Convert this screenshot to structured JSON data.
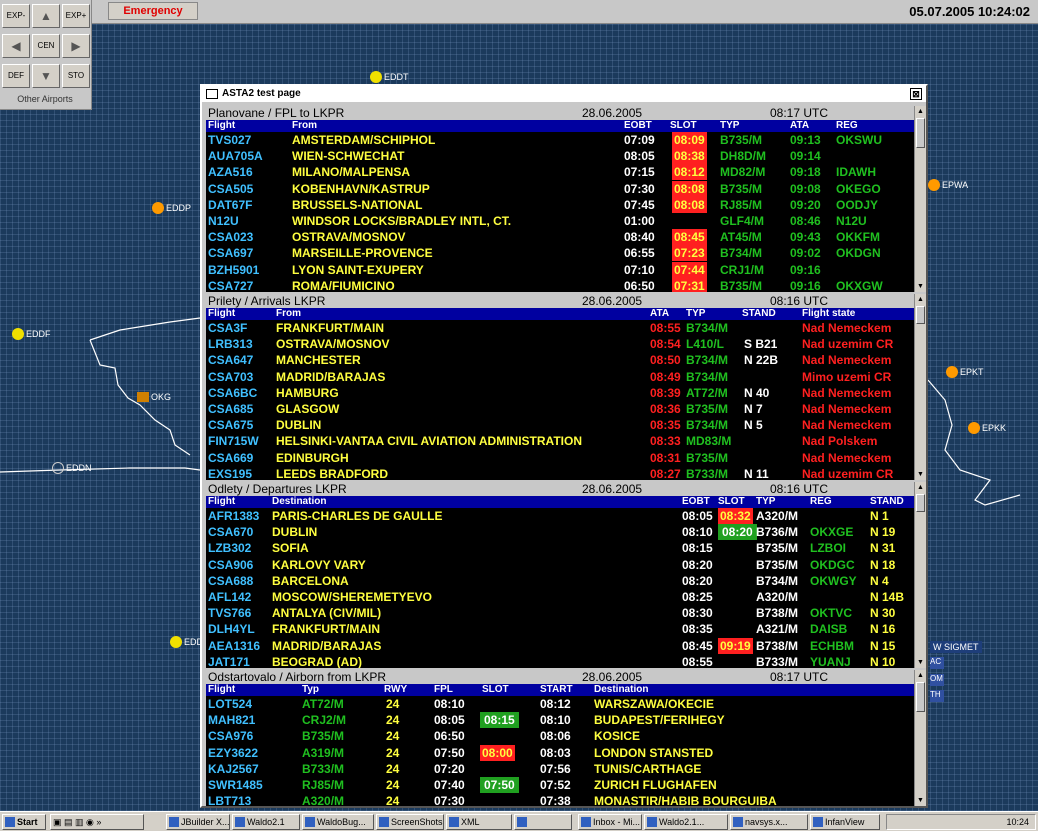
{
  "top_bar": {
    "emergency_label": "Emergency",
    "clock": "05.07.2005 10:24:02",
    "nav": {
      "exp_minus": "EXP-",
      "exp_plus": "EXP+",
      "cen": "CEN",
      "def": "DEF",
      "sto": "STO",
      "other_airports": "Other Airports"
    }
  },
  "map": {
    "airports": [
      "EDDT",
      "EDDP",
      "EDDF",
      "OKG",
      "EDDN",
      "EDD",
      "EPWA",
      "EPKT",
      "EPKK"
    ],
    "sigmet": "W SIGMET",
    "sigmet_tags": [
      "AC",
      "OM",
      "TH"
    ]
  },
  "window": {
    "title": "ASTA2 test page",
    "close": "⊠"
  },
  "fpl": {
    "header": {
      "title": "Planovane / FPL to LKPR",
      "date": "28.06.2005",
      "utc": "08:17 UTC"
    },
    "columns": {
      "flight": "Flight",
      "from": "From",
      "eobt": "EOBT",
      "slot": "SLOT",
      "typ": "TYP",
      "ata": "ATA",
      "reg": "REG"
    },
    "rows": [
      {
        "flight": "TVS027",
        "from": "AMSTERDAM/SCHIPHOL",
        "eobt": "07:09",
        "slot": "08:09",
        "typ": "B735/M",
        "ata": "09:13",
        "reg": "OKSWU"
      },
      {
        "flight": "AUA705A",
        "from": "WIEN-SCHWECHAT",
        "eobt": "08:05",
        "slot": "08:38",
        "typ": "DH8D/M",
        "ata": "09:14",
        "reg": ""
      },
      {
        "flight": "AZA516",
        "from": "MILANO/MALPENSA",
        "eobt": "07:15",
        "slot": "08:12",
        "typ": "MD82/M",
        "ata": "09:18",
        "reg": "IDAWH"
      },
      {
        "flight": "CSA505",
        "from": "KOBENHAVN/KASTRUP",
        "eobt": "07:30",
        "slot": "08:08",
        "typ": "B735/M",
        "ata": "09:08",
        "reg": "OKEGO"
      },
      {
        "flight": "DAT67F",
        "from": "BRUSSELS-NATIONAL",
        "eobt": "07:45",
        "slot": "08:08",
        "typ": "RJ85/M",
        "ata": "09:20",
        "reg": "OODJY"
      },
      {
        "flight": "N12U",
        "from": "WINDSOR LOCKS/BRADLEY INTL, CT.",
        "eobt": "01:00",
        "slot": "",
        "typ": "GLF4/M",
        "ata": "08:46",
        "reg": "N12U"
      },
      {
        "flight": "CSA023",
        "from": "OSTRAVA/MOSNOV",
        "eobt": "08:40",
        "slot": "08:45",
        "typ": "AT45/M",
        "ata": "09:43",
        "reg": "OKKFM"
      },
      {
        "flight": "CSA697",
        "from": "MARSEILLE-PROVENCE",
        "eobt": "06:55",
        "slot": "07:23",
        "typ": "B734/M",
        "ata": "09:02",
        "reg": "OKDGN"
      },
      {
        "flight": "BZH5901",
        "from": "LYON SAINT-EXUPERY",
        "eobt": "07:10",
        "slot": "07:44",
        "typ": "CRJ1/M",
        "ata": "09:16",
        "reg": ""
      },
      {
        "flight": "CSA727",
        "from": "ROMA/FIUMICINO",
        "eobt": "06:50",
        "slot": "07:31",
        "typ": "B735/M",
        "ata": "09:16",
        "reg": "OKXGW"
      }
    ]
  },
  "arrivals": {
    "header": {
      "title": "Prilety / Arrivals  LKPR",
      "date": "28.06.2005",
      "utc": "08:16 UTC"
    },
    "columns": {
      "flight": "Flight",
      "from": "From",
      "ata": "ATA",
      "typ": "TYP",
      "stand": "STAND",
      "state": "Flight state"
    },
    "rows": [
      {
        "flight": "CSA3F",
        "from": "FRANKFURT/MAIN",
        "ata": "08:55",
        "typ": "B734/M",
        "stand": "",
        "state": "Nad Nemeckem"
      },
      {
        "flight": "LRB313",
        "from": "OSTRAVA/MOSNOV",
        "ata": "08:54",
        "typ": "L410/L",
        "stand": "S B21",
        "state": "Nad uzemim CR"
      },
      {
        "flight": "CSA647",
        "from": "MANCHESTER",
        "ata": "08:50",
        "typ": "B734/M",
        "stand": "N 22B",
        "state": "Nad Nemeckem"
      },
      {
        "flight": "CSA703",
        "from": "MADRID/BARAJAS",
        "ata": "08:49",
        "typ": "B734/M",
        "stand": "",
        "state": "Mimo uzemi CR"
      },
      {
        "flight": "CSA6BC",
        "from": "HAMBURG",
        "ata": "08:39",
        "typ": "AT72/M",
        "stand": "N 40",
        "state": "Nad Nemeckem"
      },
      {
        "flight": "CSA685",
        "from": "GLASGOW",
        "ata": "08:36",
        "typ": "B735/M",
        "stand": "N 7",
        "state": "Nad Nemeckem"
      },
      {
        "flight": "CSA675",
        "from": "DUBLIN",
        "ata": "08:35",
        "typ": "B734/M",
        "stand": "N 5",
        "state": "Nad Nemeckem"
      },
      {
        "flight": "FIN715W",
        "from": "HELSINKI-VANTAA CIVIL AVIATION ADMINISTRATION",
        "ata": "08:33",
        "typ": "MD83/M",
        "stand": "",
        "state": "Nad Polskem"
      },
      {
        "flight": "CSA669",
        "from": "EDINBURGH",
        "ata": "08:31",
        "typ": "B735/M",
        "stand": "",
        "state": "Nad Nemeckem"
      },
      {
        "flight": "EXS195",
        "from": "LEEDS BRADFORD",
        "ata": "08:27",
        "typ": "B733/M",
        "stand": "N 11",
        "state": "Nad uzemim CR"
      }
    ]
  },
  "departures": {
    "header": {
      "title": "Odlety / Departures  LKPR",
      "date": "28.06.2005",
      "utc": "08:16 UTC"
    },
    "columns": {
      "flight": "Flight",
      "dest": "Destination",
      "eobt": "EOBT",
      "slot": "SLOT",
      "typ": "TYP",
      "reg": "REG",
      "stand": "STAND"
    },
    "rows": [
      {
        "flight": "AFR1383",
        "dest": "PARIS-CHARLES DE GAULLE",
        "eobt": "08:05",
        "slot": "08:32",
        "slot_color": "red",
        "typ": "A320/M",
        "reg": "",
        "stand": "N 1"
      },
      {
        "flight": "CSA670",
        "dest": "DUBLIN",
        "eobt": "08:10",
        "slot": "08:20",
        "slot_color": "green",
        "typ": "B736/M",
        "reg": "OKXGE",
        "stand": "N 19"
      },
      {
        "flight": "LZB302",
        "dest": "SOFIA",
        "eobt": "08:15",
        "slot": "",
        "slot_color": "",
        "typ": "B735/M",
        "reg": "LZBOI",
        "stand": "N 31"
      },
      {
        "flight": "CSA906",
        "dest": "KARLOVY VARY",
        "eobt": "08:20",
        "slot": "",
        "slot_color": "",
        "typ": "B735/M",
        "reg": "OKDGC",
        "stand": "N 18"
      },
      {
        "flight": "CSA688",
        "dest": "BARCELONA",
        "eobt": "08:20",
        "slot": "",
        "slot_color": "",
        "typ": "B734/M",
        "reg": "OKWGY",
        "stand": "N 4"
      },
      {
        "flight": "AFL142",
        "dest": "MOSCOW/SHEREMETYEVO",
        "eobt": "08:25",
        "slot": "",
        "slot_color": "",
        "typ": "A320/M",
        "reg": "",
        "stand": "N 14B"
      },
      {
        "flight": "TVS766",
        "dest": "ANTALYA (CIV/MIL)",
        "eobt": "08:30",
        "slot": "",
        "slot_color": "",
        "typ": "B738/M",
        "reg": "OKTVC",
        "stand": "N 30"
      },
      {
        "flight": "DLH4YL",
        "dest": "FRANKFURT/MAIN",
        "eobt": "08:35",
        "slot": "",
        "slot_color": "",
        "typ": "A321/M",
        "reg": "DAISB",
        "stand": "N 16"
      },
      {
        "flight": "AEA1316",
        "dest": "MADRID/BARAJAS",
        "eobt": "08:45",
        "slot": "09:19",
        "slot_color": "red",
        "typ": "B738/M",
        "reg": "ECHBM",
        "stand": "N 15"
      },
      {
        "flight": "JAT171",
        "dest": "BEOGRAD (AD)",
        "eobt": "08:55",
        "slot": "",
        "slot_color": "",
        "typ": "B733/M",
        "reg": "YUANJ",
        "stand": "N 10"
      }
    ]
  },
  "airborne": {
    "header": {
      "title": "Odstartovalo / Airborn from LKPR",
      "date": "28.06.2005",
      "utc": "08:17 UTC"
    },
    "columns": {
      "flight": "Flight",
      "typ": "Typ",
      "rwy": "RWY",
      "fpl": "FPL",
      "slot": "SLOT",
      "start": "START",
      "dest": "Destination"
    },
    "rows": [
      {
        "flight": "LOT524",
        "typ": "AT72/M",
        "rwy": "24",
        "fpl": "08:10",
        "slot": "",
        "slot_color": "",
        "start": "08:12",
        "dest": "WARSZAWA/OKECIE"
      },
      {
        "flight": "MAH821",
        "typ": "CRJ2/M",
        "rwy": "24",
        "fpl": "08:05",
        "slot": "08:15",
        "slot_color": "green",
        "start": "08:10",
        "dest": "BUDAPEST/FERIHEGY"
      },
      {
        "flight": "CSA976",
        "typ": "B735/M",
        "rwy": "24",
        "fpl": "06:50",
        "slot": "",
        "slot_color": "",
        "start": "08:06",
        "dest": "KOSICE"
      },
      {
        "flight": "EZY3622",
        "typ": "A319/M",
        "rwy": "24",
        "fpl": "07:50",
        "slot": "08:00",
        "slot_color": "red",
        "start": "08:03",
        "dest": "LONDON STANSTED"
      },
      {
        "flight": "KAJ2567",
        "typ": "B733/M",
        "rwy": "24",
        "fpl": "07:20",
        "slot": "",
        "slot_color": "",
        "start": "07:56",
        "dest": "TUNIS/CARTHAGE"
      },
      {
        "flight": "SWR1485",
        "typ": "RJ85/M",
        "rwy": "24",
        "fpl": "07:40",
        "slot": "07:50",
        "slot_color": "green",
        "start": "07:52",
        "dest": "ZURICH FLUGHAFEN"
      },
      {
        "flight": "LBT713",
        "typ": "A320/M",
        "rwy": "24",
        "fpl": "07:30",
        "slot": "",
        "slot_color": "",
        "start": "07:38",
        "dest": "MONASTIR/HABIB BOURGUIBA"
      }
    ]
  },
  "taskbar": {
    "start": "Start",
    "items": [
      "JBuilder X...",
      "Waldo2.1",
      "WaldoBug...",
      "ScreenShots",
      "XML",
      "",
      "Inbox - Mi...",
      "Waldo2.1...",
      "navsys.x...",
      "InfanView"
    ],
    "time": "10:24"
  }
}
